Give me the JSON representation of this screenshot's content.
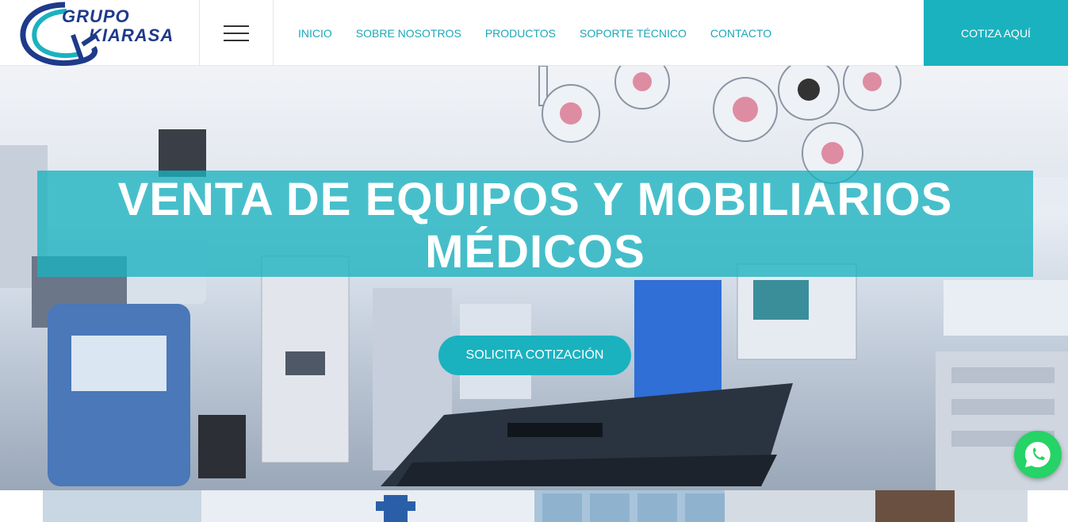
{
  "brand": {
    "word1": "GRUPO",
    "word2": "KIARASA",
    "word2_color": "#1e3a8a",
    "word1_color": "#1e3a8a",
    "accent": "#1ab2bf"
  },
  "header": {
    "menu_icon": "hamburger-menu-icon",
    "nav": [
      {
        "label": "INICIO"
      },
      {
        "label": "SOBRE NOSOTROS"
      },
      {
        "label": "PRODUCTOS"
      },
      {
        "label": "SOPORTE TÉCNICO"
      },
      {
        "label": "CONTACTO"
      }
    ],
    "cta_label": "COTIZA AQUÍ",
    "cta_color": "#1ab2bf"
  },
  "hero": {
    "title_line1": "VENTA DE EQUIPOS Y MOBILIARIOS",
    "title_line2": "MÉDICOS",
    "button_label": "SOLICITA COTIZACIÓN",
    "button_color": "#1ab2bf"
  },
  "floating": {
    "whatsapp_icon": "whatsapp-icon",
    "whatsapp_color": "#25d366"
  }
}
